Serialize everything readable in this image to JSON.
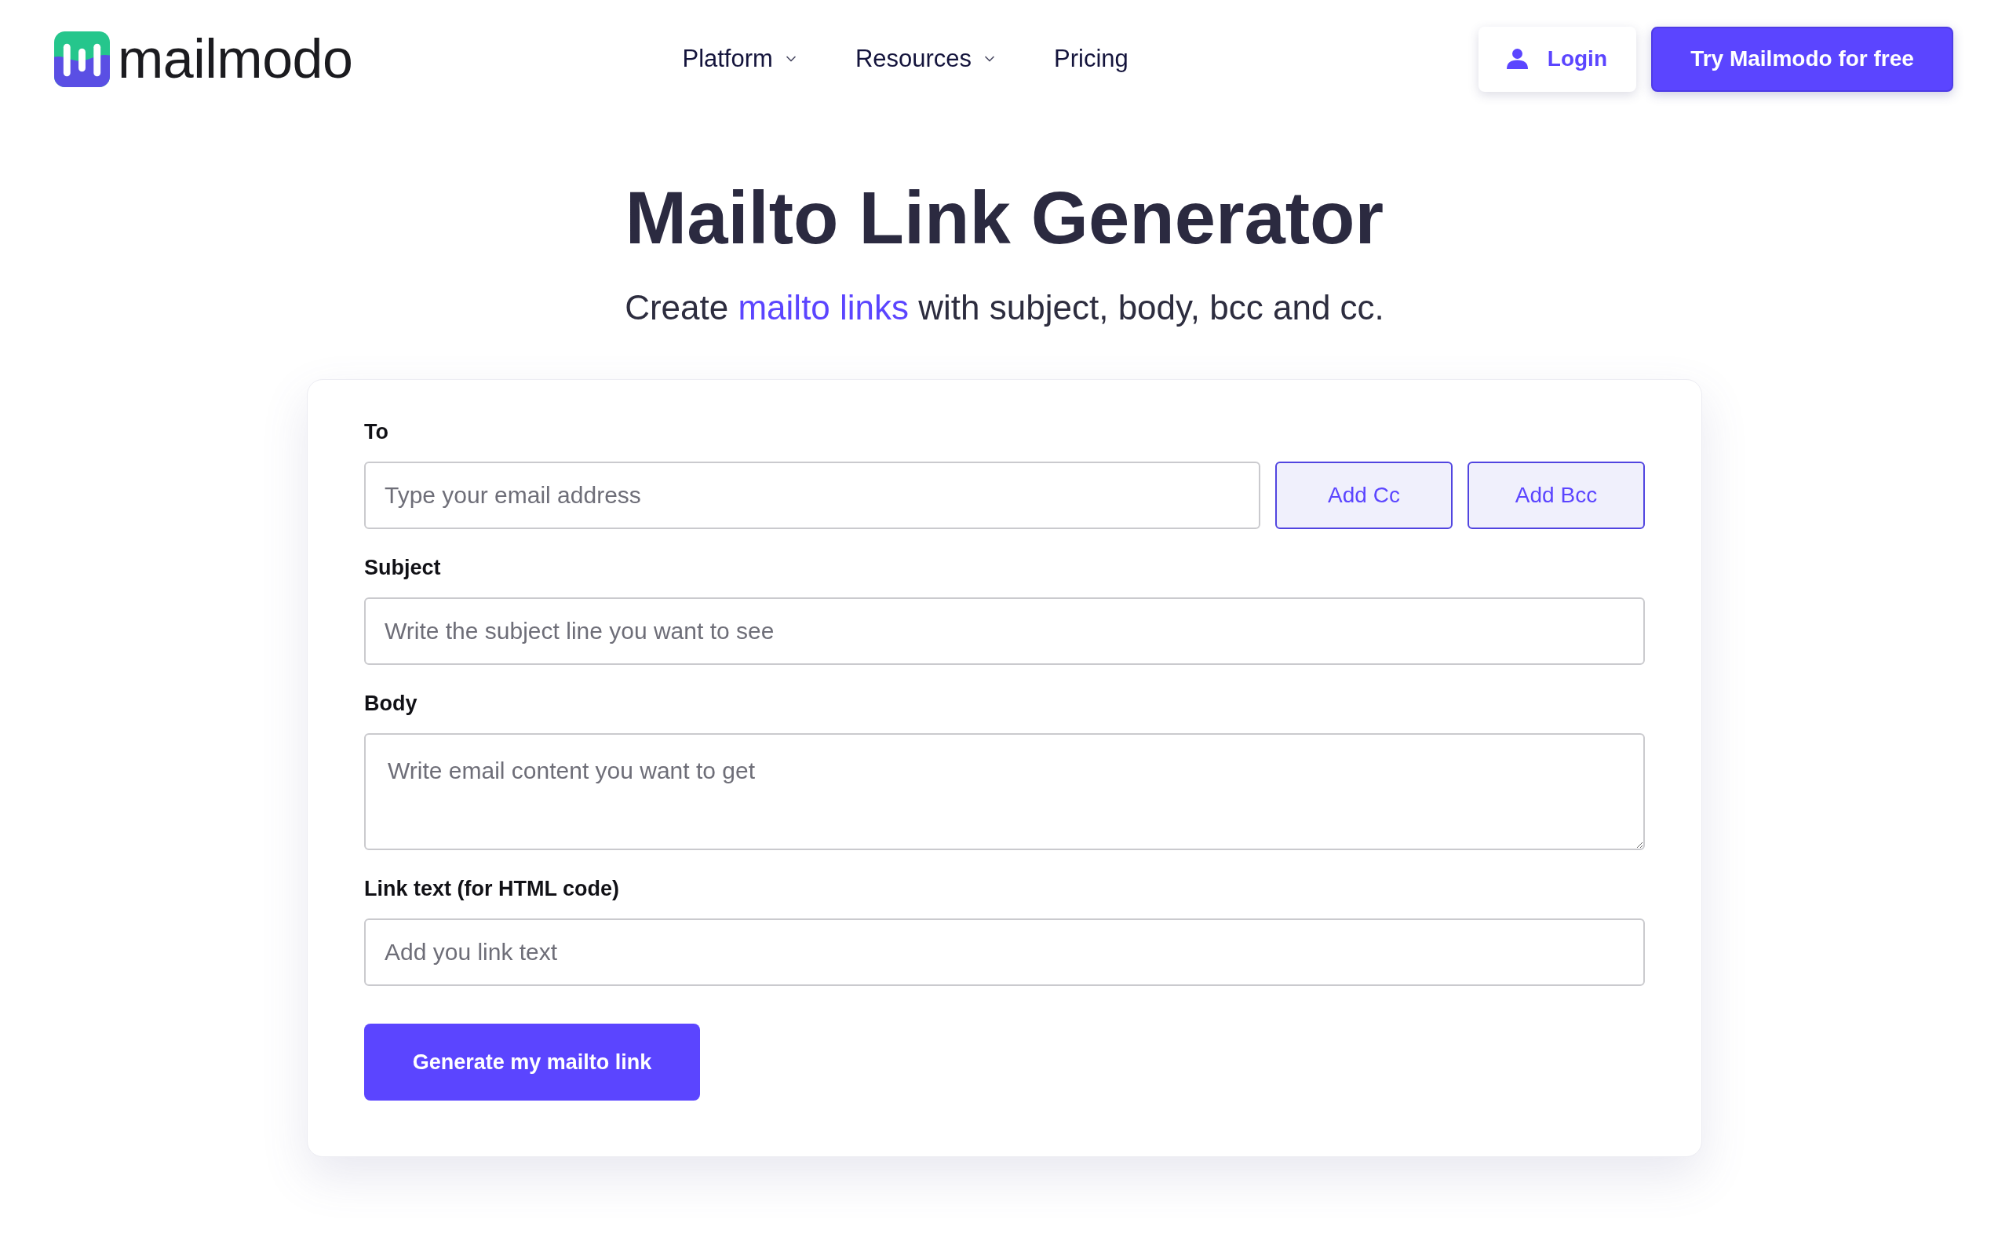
{
  "header": {
    "logo_text": "mailmodo",
    "nav": [
      {
        "label": "Platform",
        "has_menu": true
      },
      {
        "label": "Resources",
        "has_menu": true
      },
      {
        "label": "Pricing",
        "has_menu": false
      }
    ],
    "login_button": "Login",
    "cta_button": "Try Mailmodo for free"
  },
  "hero": {
    "title": "Mailto Link Generator",
    "subtitle": {
      "before": "Create ",
      "link": "mailto links",
      "after": " with subject, body, bcc and cc."
    }
  },
  "form": {
    "fields": [
      {
        "kind": "input",
        "label": "To",
        "placeholder": "Type your email address",
        "buttons": [
          "Add Cc",
          "Add Bcc"
        ]
      },
      {
        "kind": "input",
        "label": "Subject",
        "placeholder": "Write the subject line you want to see"
      },
      {
        "kind": "textarea",
        "label": "Body",
        "placeholder": "Write email content you want to get"
      },
      {
        "kind": "input",
        "label": "Link text (for HTML code)",
        "placeholder": "Add you link text"
      }
    ],
    "submit_button": "Generate my mailto link"
  }
}
